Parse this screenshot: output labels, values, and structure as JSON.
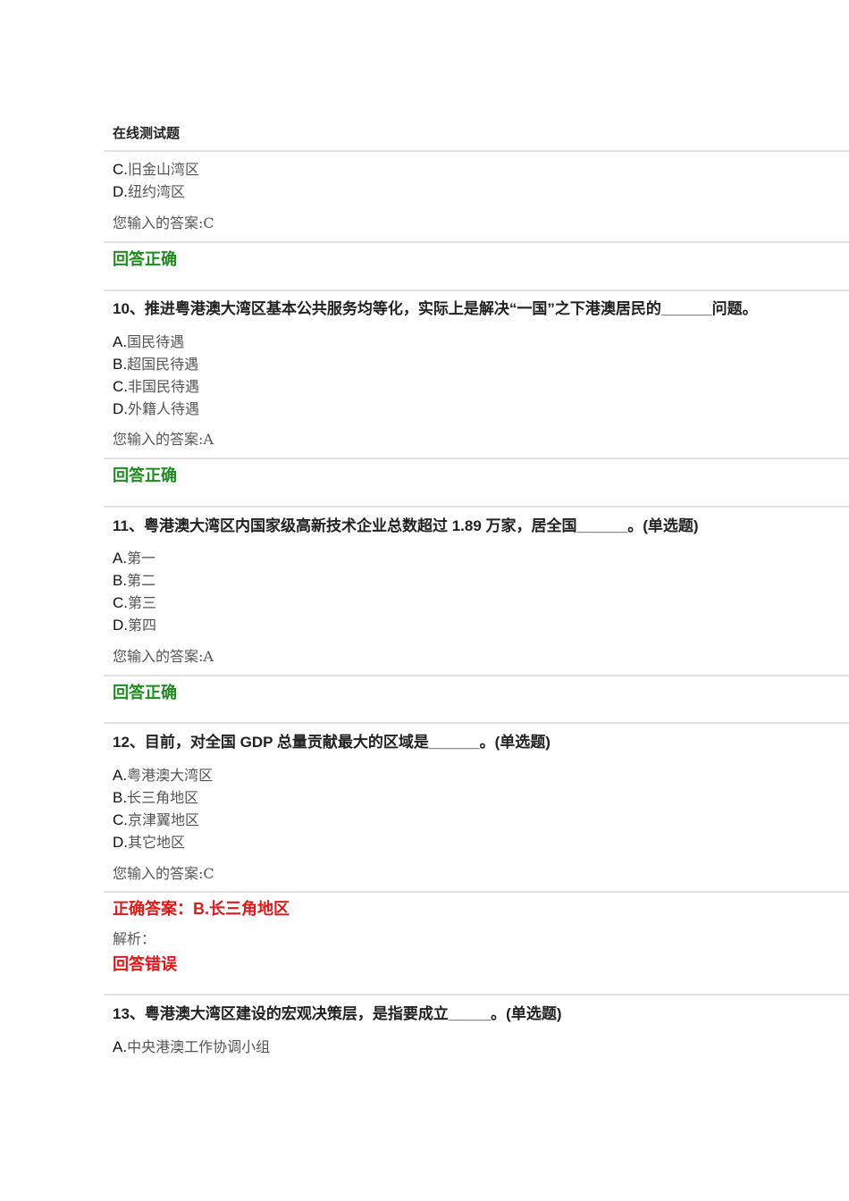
{
  "page_title": "在线测试题",
  "q9": {
    "options": [
      {
        "letter": "C.",
        "text": "旧金山湾区"
      },
      {
        "letter": "D.",
        "text": "纽约湾区"
      }
    ],
    "your_answer": "您输入的答案:C",
    "result": "回答正确"
  },
  "q10": {
    "question": "10、推进粤港澳大湾区基本公共服务均等化，实际上是解决“一国”之下港澳居民的______问题。",
    "options": [
      {
        "letter": "A.",
        "text": "国民待遇"
      },
      {
        "letter": "B.",
        "text": "超国民待遇"
      },
      {
        "letter": "C.",
        "text": "非国民待遇"
      },
      {
        "letter": "D.",
        "text": "外籍人待遇"
      }
    ],
    "your_answer": "您输入的答案:A",
    "result": "回答正确"
  },
  "q11": {
    "question": "11、粤港澳大湾区内国家级高新技术企业总数超过 1.89 万家，居全国______。(单选题)",
    "options": [
      {
        "letter": "A.",
        "text": "第一"
      },
      {
        "letter": "B.",
        "text": "第二"
      },
      {
        "letter": "C.",
        "text": "第三"
      },
      {
        "letter": "D.",
        "text": "第四"
      }
    ],
    "your_answer": "您输入的答案:A",
    "result": "回答正确"
  },
  "q12": {
    "question": "12、目前，对全国 GDP 总量贡献最大的区域是______。(单选题)",
    "options": [
      {
        "letter": "A.",
        "text": "粤港澳大湾区"
      },
      {
        "letter": "B.",
        "text": "长三角地区"
      },
      {
        "letter": "C.",
        "text": "京津翼地区"
      },
      {
        "letter": "D.",
        "text": "其它地区"
      }
    ],
    "your_answer": "您输入的答案:C",
    "correct_answer": "正确答案：B.长三角地区",
    "analysis": "解析：",
    "result": "回答错误"
  },
  "q13": {
    "question": "13、粤港澳大湾区建设的宏观决策层，是指要成立_____。(单选题)",
    "options": [
      {
        "letter": "A.",
        "text": "中央港澳工作协调小组"
      }
    ]
  }
}
